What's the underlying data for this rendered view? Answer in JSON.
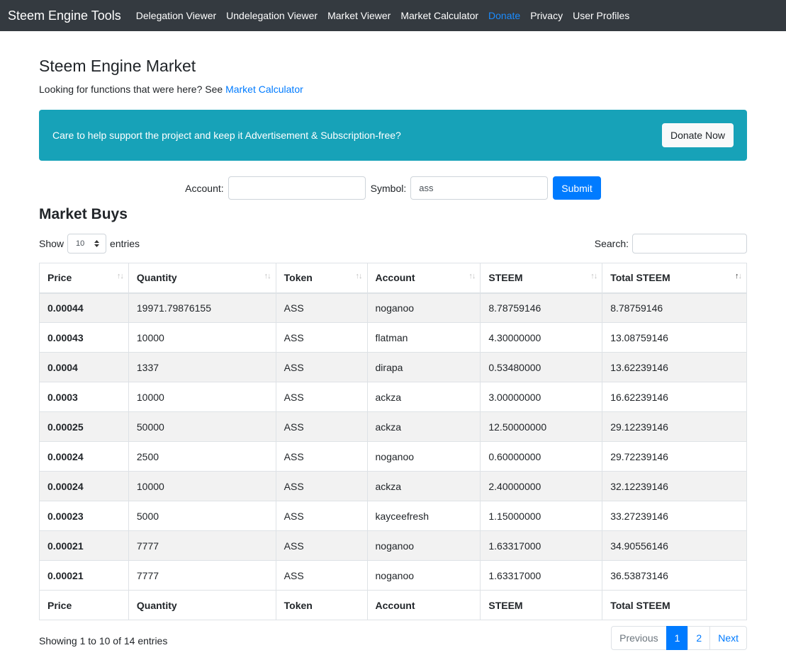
{
  "navbar": {
    "brand": "Steem Engine Tools",
    "items": [
      {
        "label": "Delegation Viewer"
      },
      {
        "label": "Undelegation Viewer"
      },
      {
        "label": "Market Viewer"
      },
      {
        "label": "Market Calculator"
      },
      {
        "label": "Donate"
      },
      {
        "label": "Privacy"
      },
      {
        "label": "User Profiles"
      }
    ]
  },
  "page": {
    "title": "Steem Engine Market",
    "subtitle_prefix": "Looking for functions that were here? See",
    "subtitle_link": "Market Calculator"
  },
  "alert": {
    "text": "Care to help support the project and keep it Advertisement & Subscription-free?",
    "button": "Donate Now"
  },
  "form": {
    "account_label": "Account:",
    "account_value": "",
    "symbol_label": "Symbol:",
    "symbol_value": "ass",
    "submit": "Submit"
  },
  "section": {
    "title": "Market Buys"
  },
  "controls": {
    "show": "Show",
    "page_size": "10",
    "entries": "entries",
    "search_label": "Search:"
  },
  "table": {
    "headers": [
      "Price",
      "Quantity",
      "Token",
      "Account",
      "STEEM",
      "Total STEEM"
    ],
    "rows": [
      [
        "0.00044",
        "19971.79876155",
        "ASS",
        "noganoo",
        "8.78759146",
        "8.78759146"
      ],
      [
        "0.00043",
        "10000",
        "ASS",
        "flatman",
        "4.30000000",
        "13.08759146"
      ],
      [
        "0.0004",
        "1337",
        "ASS",
        "dirapa",
        "0.53480000",
        "13.62239146"
      ],
      [
        "0.0003",
        "10000",
        "ASS",
        "ackza",
        "3.00000000",
        "16.62239146"
      ],
      [
        "0.00025",
        "50000",
        "ASS",
        "ackza",
        "12.50000000",
        "29.12239146"
      ],
      [
        "0.00024",
        "2500",
        "ASS",
        "noganoo",
        "0.60000000",
        "29.72239146"
      ],
      [
        "0.00024",
        "10000",
        "ASS",
        "ackza",
        "2.40000000",
        "32.12239146"
      ],
      [
        "0.00023",
        "5000",
        "ASS",
        "kayceefresh",
        "1.15000000",
        "33.27239146"
      ],
      [
        "0.00021",
        "7777",
        "ASS",
        "noganoo",
        "1.63317000",
        "34.90556146"
      ],
      [
        "0.00021",
        "7777",
        "ASS",
        "noganoo",
        "1.63317000",
        "36.53873146"
      ]
    ]
  },
  "footer": {
    "info": "Showing 1 to 10 of 14 entries",
    "previous": "Previous",
    "pages": [
      "1",
      "2"
    ],
    "next": "Next"
  }
}
